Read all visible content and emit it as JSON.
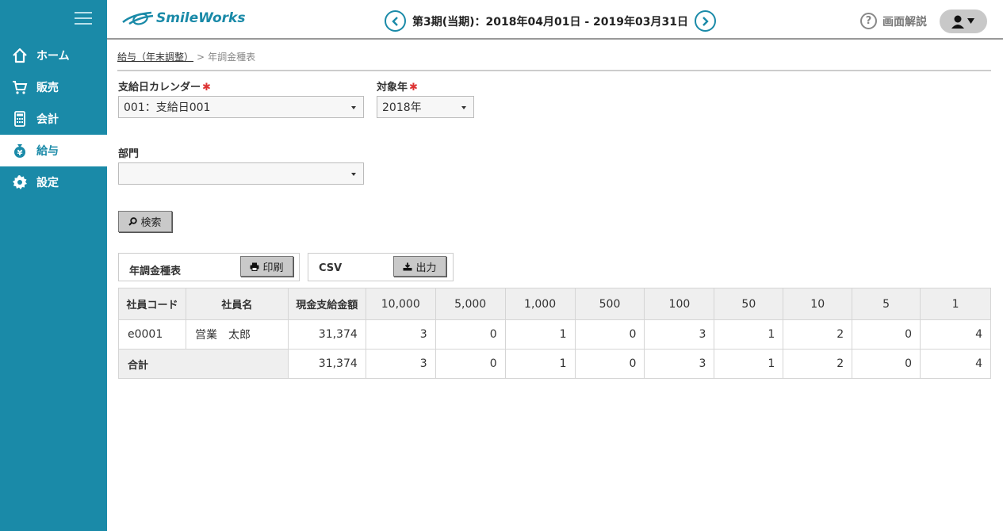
{
  "sidebar": {
    "items": [
      {
        "label": "ホーム",
        "icon": "home-icon"
      },
      {
        "label": "販売",
        "icon": "cart-icon"
      },
      {
        "label": "会計",
        "icon": "calculator-icon"
      },
      {
        "label": "給与",
        "icon": "money-bag-icon",
        "active": true
      },
      {
        "label": "設定",
        "icon": "gear-icon"
      }
    ]
  },
  "header": {
    "logo": "SmileWorks",
    "period": "第3期(当期)：2018年04月01日 - 2019年03月31日",
    "help": "画面解説"
  },
  "breadcrumb": {
    "parent": "給与（年末調整）",
    "separator": ">",
    "current": "年調金種表"
  },
  "form": {
    "calendar_label": "支給日カレンダー",
    "calendar_value": "001：支給日001",
    "year_label": "対象年",
    "year_value": "2018年",
    "required_mark": "✱",
    "dept_label": "部門",
    "dept_value": "",
    "search_button": "検索"
  },
  "actions": {
    "print_label": "年調金種表",
    "print_button": "印刷",
    "csv_label": "CSV",
    "csv_button": "出力"
  },
  "table": {
    "headers": [
      "社員コード",
      "社員名",
      "現金支給金額",
      "10,000",
      "5,000",
      "1,000",
      "500",
      "100",
      "50",
      "10",
      "5",
      "1"
    ],
    "rows": [
      [
        "e0001",
        "営業　太郎",
        "31,374",
        "3",
        "0",
        "1",
        "0",
        "3",
        "1",
        "2",
        "0",
        "4"
      ]
    ],
    "total": {
      "label": "合計",
      "values": [
        "31,374",
        "3",
        "0",
        "1",
        "0",
        "3",
        "1",
        "2",
        "0",
        "4"
      ]
    }
  },
  "colors": {
    "sidebar": "#1a8aa8",
    "accent": "#1a8aa8",
    "required": "#dd3333"
  }
}
